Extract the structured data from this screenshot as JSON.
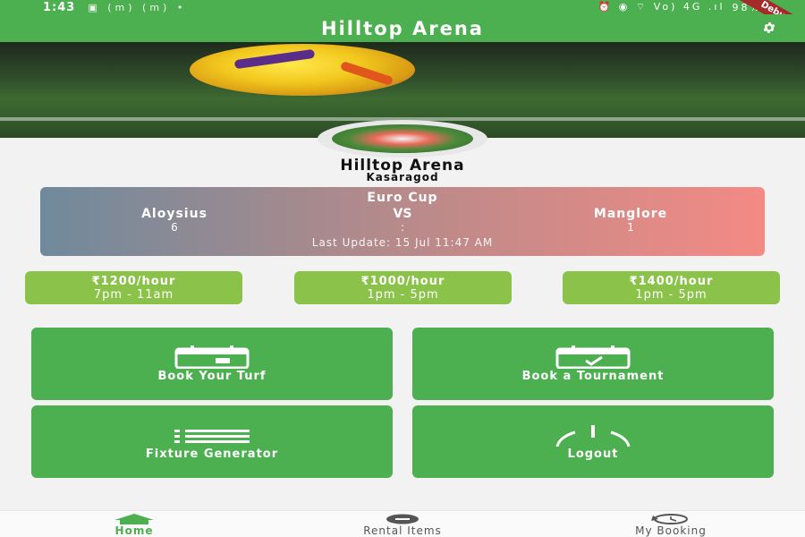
{
  "status_bar": {
    "time": "1:43",
    "left_icons": "▣ (m) (m) •",
    "right_icons": "⏰ ◉ ⌔ Vo) 4G .ıl",
    "battery": "98%",
    "debug_label": "Debug"
  },
  "app_bar": {
    "title": "Hilltop Arena",
    "settings_icon": "gear-icon"
  },
  "profile": {
    "name": "Hilltop Arena",
    "location": "Kasaragod"
  },
  "match": {
    "event": "Euro Cup",
    "team_a": "Aloysius",
    "vs": "VS",
    "team_b": "Manglore",
    "score_a": "6",
    "separator": ":",
    "score_b": "1",
    "last_update": "Last Update: 15 Jul 11:47 AM"
  },
  "rates": [
    {
      "price": "₹1200/hour",
      "slot": "7pm - 11am"
    },
    {
      "price": "₹1000/hour",
      "slot": "1pm - 5pm"
    },
    {
      "price": "₹1400/hour",
      "slot": "1pm - 5pm"
    }
  ],
  "actions": [
    {
      "label": "Book Your Turf",
      "icon": "calendar-icon"
    },
    {
      "label": "Book a Tournament",
      "icon": "calendar-check-icon"
    },
    {
      "label": "Fixture Generator",
      "icon": "list-icon"
    },
    {
      "label": "Logout",
      "icon": "power-icon"
    }
  ],
  "bottom_nav": [
    {
      "label": "Home",
      "icon": "home-icon",
      "active": true
    },
    {
      "label": "Rental Items",
      "icon": "football-icon",
      "active": false
    },
    {
      "label": "My Booking",
      "icon": "history-icon",
      "active": false
    }
  ],
  "colors": {
    "primary": "#4caf50",
    "chip": "#8bc34a",
    "debug": "#a52a2a"
  }
}
